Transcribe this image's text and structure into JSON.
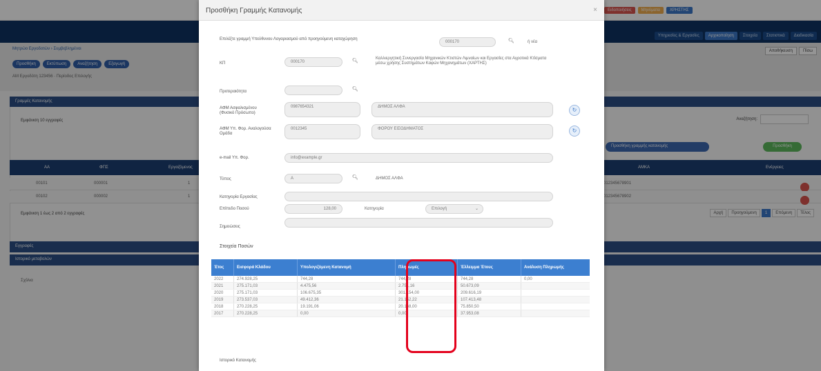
{
  "background": {
    "nav_tabs": [
      "Υπηρεσίες & Εργασίες",
      "Αρχικοποίηση",
      "Στοιχεία",
      "Στατιστικά",
      "Διαδικασία"
    ],
    "breadcrumb": "Μητρώο Εργοδοτών › Συμβεβλημένοι",
    "pills": [
      "Προσθήκη",
      "Εκτύπωση",
      "Αναζήτηση",
      "Εξαγωγή"
    ],
    "subtext": "ΑΜ Εργοδότη 123456 · Περίοδος Επιλογής",
    "right_buttons": [
      "Αποθήκευση",
      "Πίσω"
    ],
    "panel_title": "Γραμμές Κατανομής",
    "show_line": "Εμφάνιση 10 εγγραφές",
    "search_label": "Αναζήτηση:",
    "blue_btn": "Προσθήκη γραμμής κατανομής",
    "green_btn": "Προσθήκη",
    "table_headers": [
      "ΑΑ",
      "ΦΠΣ",
      "Εργαζόμενος",
      "ΑΜΚΑ",
      "Ενέργειες"
    ],
    "rows": [
      [
        "00101",
        "000001",
        "1",
        "012345678901"
      ],
      [
        "00102",
        "000002",
        "1",
        "012345678902"
      ]
    ],
    "paging": "Εμφάνιση 1 έως 2 από 2 εγγραφές",
    "pager": [
      "Αρχή",
      "Προηγούμενη",
      "1",
      "Επόμενη",
      "Τέλος"
    ],
    "section1": "Εγγραφές",
    "section2": "Ιστορικό μεταβολών",
    "bottom_label": "Σχόλια"
  },
  "top_widgets": [
    "Ειδοποιήσεις",
    "Μηνύματα",
    "ΧΡΗΣΤΗΣ"
  ],
  "modal": {
    "title": "Προσθήκη Γραμμής Κατανομής",
    "close": "×",
    "fields": {
      "select_label": "Επιλέξτε γραμμή Υπεύθυνου Λογαριασμού από προηγούμενη καταχώρηση",
      "select_value": "000170",
      "select_hint": "ή νέα",
      "ks_label": "ΚΠ",
      "ks_value": "000170",
      "ks_desc": "Καλλιεργητική Συνεργασία Μηχανικών Κτιστών Λιμναίων και Εργασίες στα Αγροτικά Κτίσματα μέσω χρήσης Συστημάτων Καφών Μηχανημάτων (ΧΑΡΤΗΣ)",
      "shift_label": "Προτεραιότητα",
      "afm_label": "ΑΦΜ Ασφαλισμένου (Φυσικό Πρόσωπο)",
      "afm_value": "0987654321",
      "afm_name": "ΔΗΜΟΣ ΑΛΦΑ",
      "afm2_label": "ΑΦΜ Υπ. Φορ. Αναλογούσα Ομάδα",
      "afm2_value": "0012345",
      "afm2_name": "ΦΟΡΟΥ ΕΙΣΟΔΗΜΑΤΟΣ",
      "email_label": "e-mail Υπ. Φορ.",
      "email_value": "info@example.gr",
      "type_label": "Τύπος",
      "type_value": "Α",
      "type_desc": "ΔΗΜΟΣ ΑΛΦΑ",
      "role_label": "Κατηγορία Εργασίας",
      "period_label": "Επίπεδο Ποσού",
      "period_value": "128,00",
      "period_mid": "Κατηγορία",
      "period_select": "Επιλογή",
      "notes_label": "Σημειώσεις"
    },
    "section_title": "Στοιχεία Ποσών",
    "table": {
      "headers": [
        "Έτος",
        "Εισφορά Κλάδου",
        "Υπολογιζόμενη Κατανομή",
        "Πληρωμές",
        "Έλλειμμα Έτους",
        "Ανάλυση Πληρωμής"
      ],
      "rows": [
        [
          "2022",
          "274.928,25",
          "744,28",
          "744,28",
          "744,28",
          "0,00"
        ],
        [
          "2021",
          "275.171,03",
          "4.475,56",
          "2.751,16",
          "50.673,09",
          ""
        ],
        [
          "2020",
          "275.171,03",
          "106.675,35",
          "301.154,00",
          "209.616,19",
          ""
        ],
        [
          "2019",
          "273.537,03",
          "49.412,36",
          "21.152,22",
          "107.413,48",
          ""
        ],
        [
          "2018",
          "270.228,25",
          "19.191,06",
          "20.168,00",
          "75.850,50",
          ""
        ],
        [
          "2017",
          "270.228,25",
          "0,00",
          "0,00",
          "37.953,08",
          ""
        ]
      ]
    },
    "footer_label": "Ιστορικό Κατανομής"
  }
}
